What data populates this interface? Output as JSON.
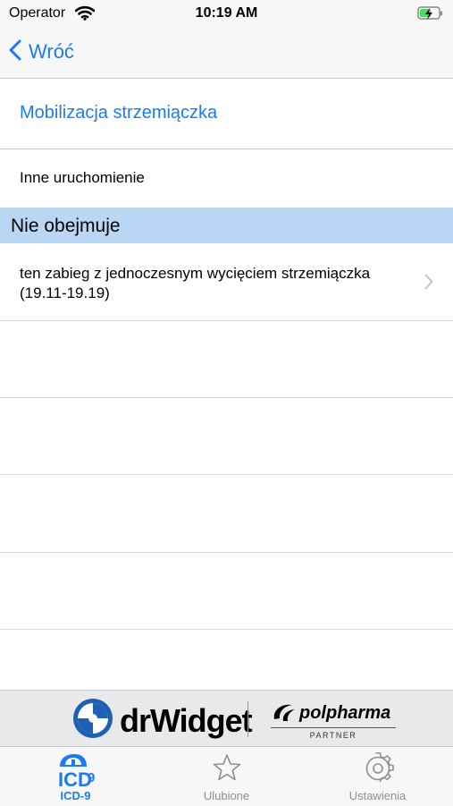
{
  "status": {
    "carrier": "Operator",
    "time": "10:19 AM"
  },
  "nav": {
    "back_label": "Wróć"
  },
  "detail": {
    "title": "Mobilizacja strzemiączka",
    "info": "Inne uruchomienie",
    "section_header": "Nie obejmuje",
    "rows": [
      {
        "text": "ten zabieg z jednoczesnym wycięciem strzemiączka (19.11-19.19)"
      }
    ]
  },
  "banner": {
    "drwidget_label": "drWidget",
    "polpharma_label": "polpharma",
    "partner_label": "PARTNER"
  },
  "tabs": [
    {
      "label": "ICD-9",
      "icon": "icd9-icon",
      "active": true
    },
    {
      "label": "Ulubione",
      "icon": "star-icon",
      "active": false
    },
    {
      "label": "Ustawienia",
      "icon": "gear-icon",
      "active": false
    }
  ],
  "colors": {
    "accent": "#1a7cf2",
    "section_header_bg": "#bad6f5",
    "bar_bg": "#f7f7f7"
  }
}
